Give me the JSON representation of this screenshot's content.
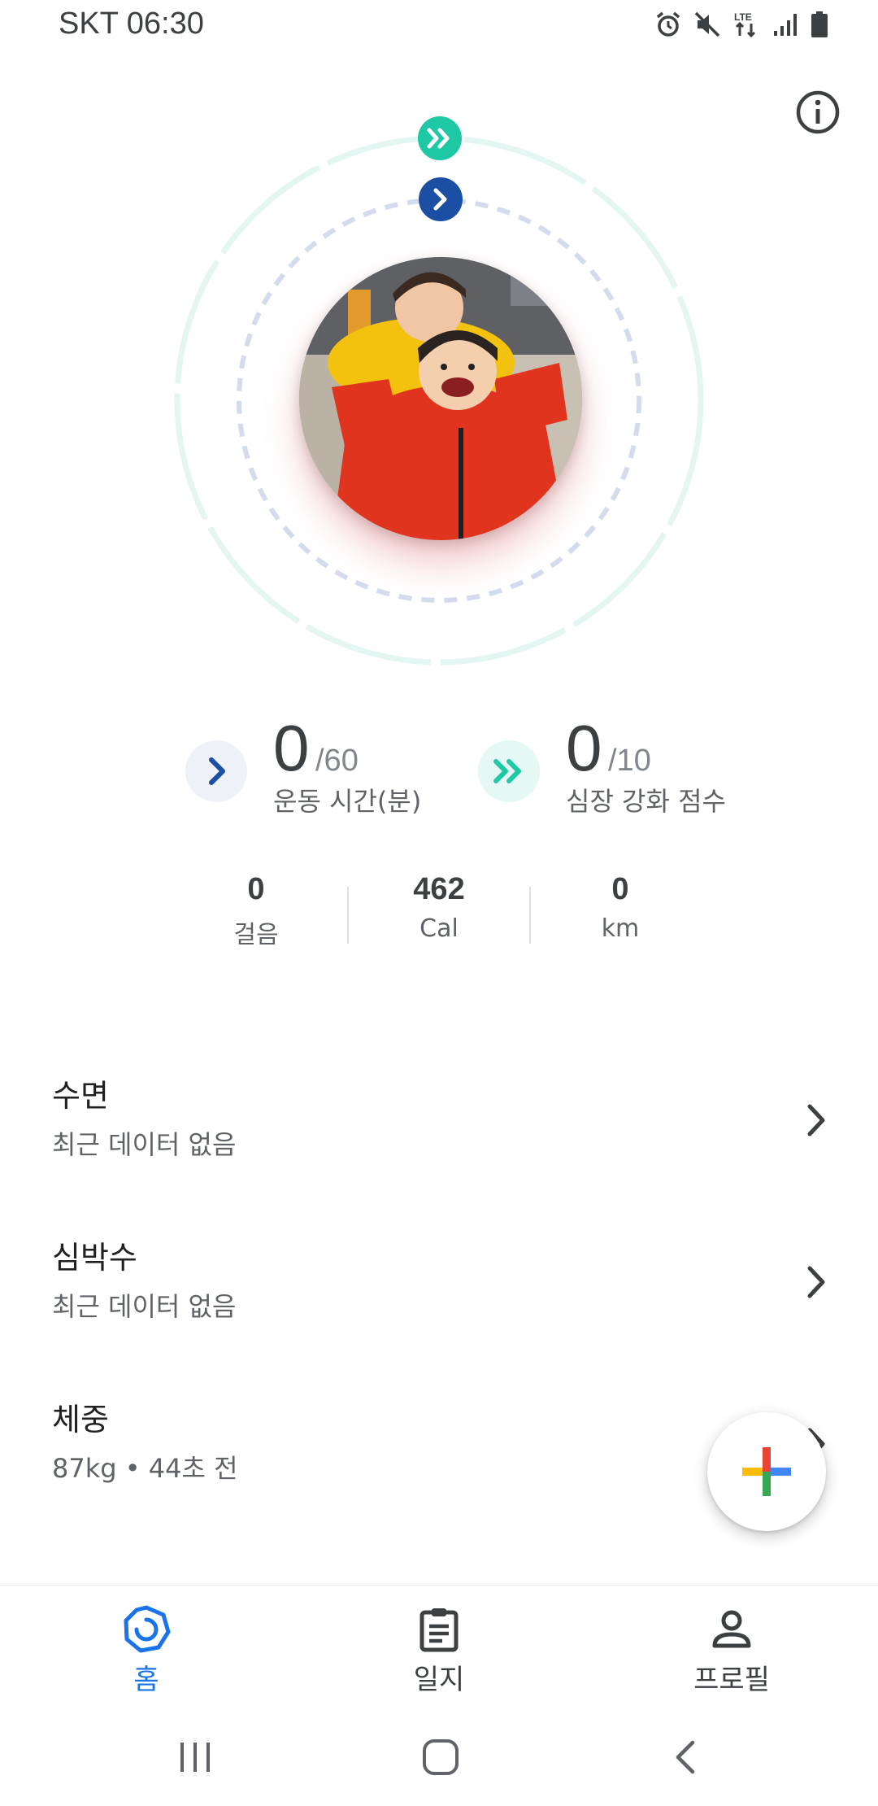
{
  "status_bar": {
    "carrier_time": "SKT 06:30",
    "icons": [
      "alarm-icon",
      "mute-icon",
      "lte-icon",
      "signal-icon",
      "battery-icon"
    ],
    "lte_label": "LTE"
  },
  "header": {
    "info_icon": "info-icon"
  },
  "rings": {
    "heart_points_color": "#1ec8a5",
    "move_minutes_color": "#1a4fa3"
  },
  "metrics": {
    "move_minutes": {
      "value": "0",
      "goal": "/60",
      "label": "운동 시간(분)"
    },
    "heart_points": {
      "value": "0",
      "goal": "/10",
      "label": "심장 강화 점수"
    }
  },
  "stats": [
    {
      "value": "0",
      "unit": "걸음"
    },
    {
      "value": "462",
      "unit": "Cal"
    },
    {
      "value": "0",
      "unit": "km"
    }
  ],
  "cards": [
    {
      "title": "수면",
      "subtitle": "최근 데이터 없음"
    },
    {
      "title": "심박수",
      "subtitle": "최근 데이터 없음"
    },
    {
      "title": "체중",
      "subtitle": "87kg • 44초 전"
    }
  ],
  "fab": {
    "icon": "plus-icon"
  },
  "bottom_nav": [
    {
      "label": "홈",
      "icon": "home-ring-icon",
      "active": true
    },
    {
      "label": "일지",
      "icon": "journal-icon",
      "active": false
    },
    {
      "label": "프로필",
      "icon": "profile-icon",
      "active": false
    }
  ],
  "colors": {
    "accent_blue": "#1a73e8",
    "teal": "#1ec8a5",
    "navy": "#1a4fa3"
  }
}
